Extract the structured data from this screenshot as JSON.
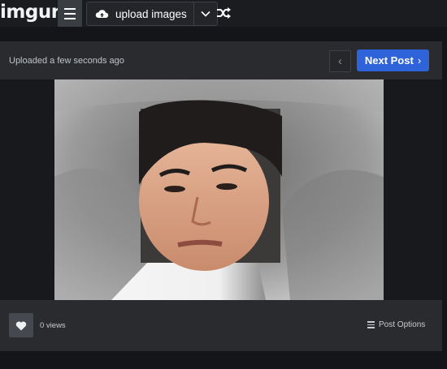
{
  "header": {
    "logo": "imgur",
    "upload_label": "upload images",
    "icons": [
      "hamburger-menu-icon",
      "cloud-upload-icon",
      "chevron-down-icon",
      "shuffle-icon"
    ]
  },
  "post": {
    "meta": "Uploaded a few seconds ago",
    "next_label": "Next Post",
    "next_chevron": "›",
    "prev_chevron": "‹",
    "accent_color": "#2e63d9"
  },
  "footer": {
    "views": "0 views",
    "options_label": "Post Options"
  }
}
